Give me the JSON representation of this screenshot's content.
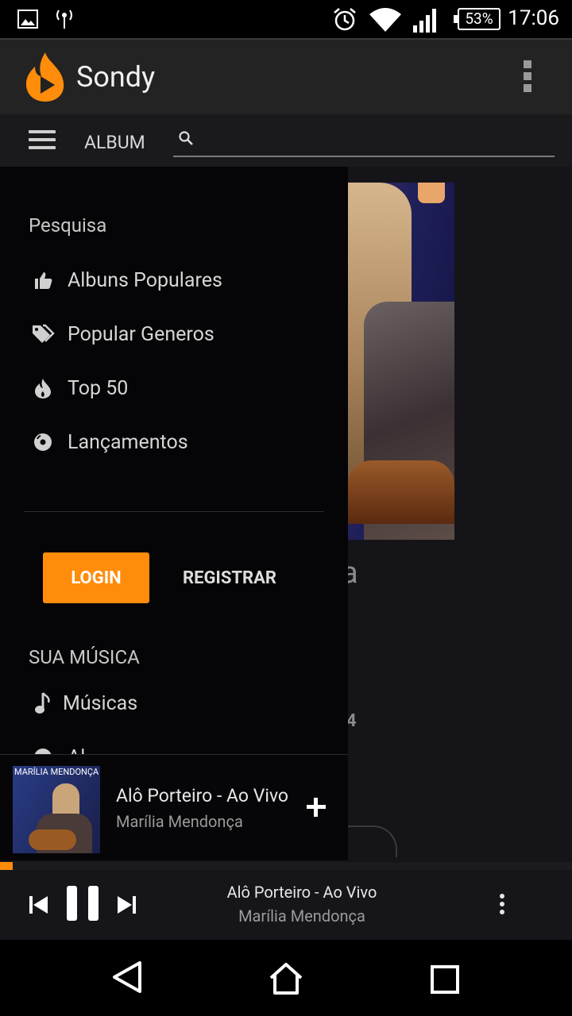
{
  "status_bar": {
    "battery": "53%",
    "time": "17:06",
    "icons": [
      "image-icon",
      "antenna-icon",
      "alarm-icon",
      "wifi-icon",
      "signal-icon",
      "battery-icon"
    ]
  },
  "app": {
    "title": "Sondy",
    "accent_color": "#ff8c0a"
  },
  "toolbar": {
    "album_label": "ALBUM",
    "search_value": "",
    "search_placeholder": ""
  },
  "drawer": {
    "search_section": "Pesquisa",
    "items": [
      {
        "label": "Albuns Populares",
        "icon": "thumbs-up-icon"
      },
      {
        "label": "Popular Generos",
        "icon": "tags-icon"
      },
      {
        "label": "Top 50",
        "icon": "fire-icon"
      },
      {
        "label": "Lançamentos",
        "icon": "disc-icon"
      }
    ],
    "login_label": "LOGIN",
    "register_label": "REGISTRAR",
    "music_section": "SUA MÚSICA",
    "music_items": [
      {
        "label": "Músicas",
        "icon": "music-note-icon"
      },
      {
        "label": "Al",
        "icon": "album-icon"
      }
    ]
  },
  "background_content": {
    "peek_text_a": "a",
    "peek_text_4": "4"
  },
  "mini_player": {
    "cover_text": "MARÍLIA MENDONÇA",
    "title": "Alô Porteiro - Ao Vivo",
    "artist": "Marília Mendonça",
    "add_icon": "plus-icon"
  },
  "player": {
    "title": "Alô Porteiro - Ao Vivo",
    "artist": "Marília Mendonça",
    "progress": 0.022
  }
}
